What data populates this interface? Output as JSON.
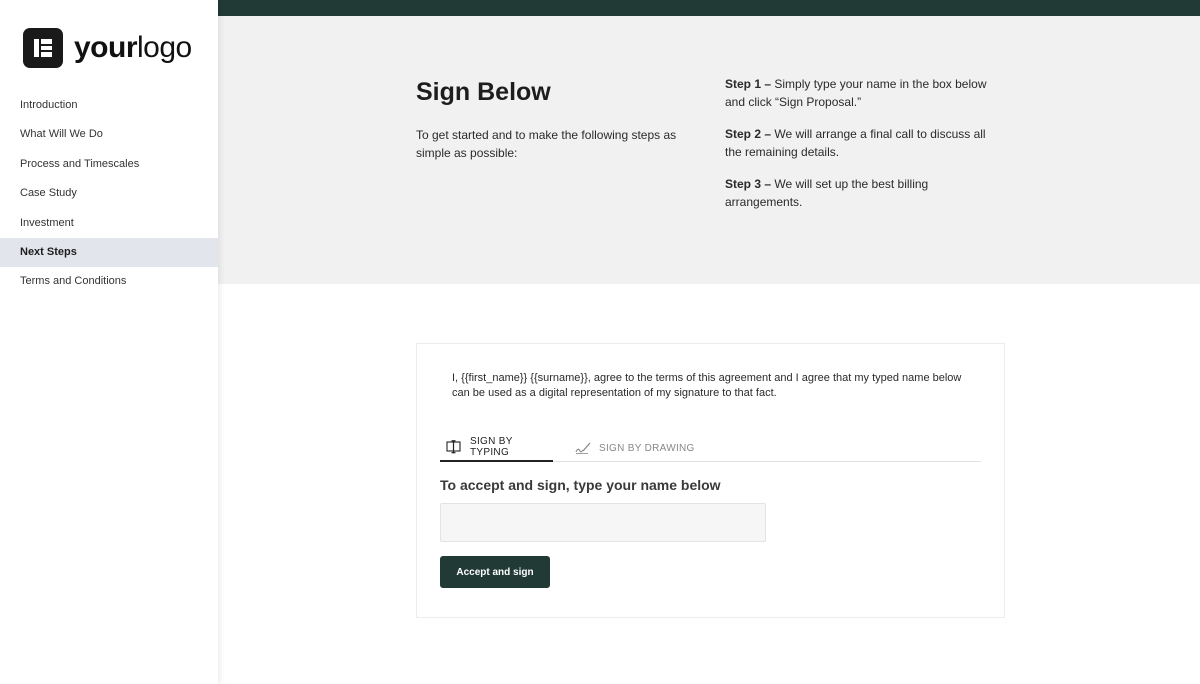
{
  "brand": {
    "logo_bold": "your",
    "logo_light": "logo"
  },
  "nav": {
    "items": [
      {
        "label": "Introduction"
      },
      {
        "label": "What Will We Do"
      },
      {
        "label": "Process and Timescales"
      },
      {
        "label": "Case Study"
      },
      {
        "label": "Investment"
      },
      {
        "label": "Next Steps"
      },
      {
        "label": "Terms and Conditions"
      }
    ],
    "active": "Next Steps"
  },
  "hero": {
    "title": "Sign Below",
    "intro": "To get started and to make the following steps as simple as possible:",
    "steps": [
      {
        "label": "Step 1 –",
        "text": "Simply type your name in the box below and click “Sign Proposal.”"
      },
      {
        "label": "Step 2 –",
        "text": "We will arrange a final call to discuss all the remaining details."
      },
      {
        "label": "Step 3 –",
        "text": "We will set up the best billing arrangements."
      }
    ]
  },
  "signature": {
    "agreement": "I, {{first_name}} {{surname}}, agree to the terms of this agreement and I agree that my typed name below can be used as a digital representation of my signature to that fact.",
    "tabs": [
      {
        "label": "SIGN BY TYPING",
        "icon": "keyboard-cursor-icon",
        "active": true
      },
      {
        "label": "SIGN BY DRAWING",
        "icon": "pen-signature-icon",
        "active": false
      }
    ],
    "prompt": "To accept and sign, type your name below",
    "input_value": "",
    "input_placeholder": "",
    "button_label": "Accept and sign"
  },
  "colors": {
    "accent_dark": "#213a36",
    "hero_bg": "#f1f1f1",
    "active_nav_bg": "#e3e5ec"
  }
}
